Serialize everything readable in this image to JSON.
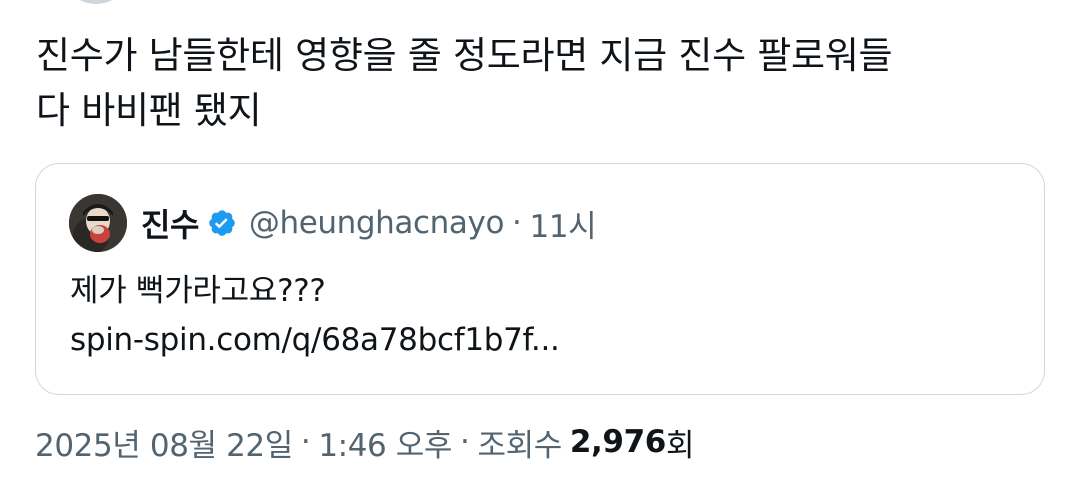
{
  "tweet": {
    "text": "진수가 남들한테 영향을 줄 정도라면 지금 진수 팔로워들\n다 바비팬 됐지"
  },
  "quote": {
    "name": "진수",
    "handle": "@heunghacnayo",
    "dot": "·",
    "time": "11시",
    "text_line1": "제가 뻑가라고요???",
    "link": "spin-spin.com/q/68a78bcf1b7f...",
    "verified_icon": "verified-badge-icon",
    "verified_color": "#1d9bf0"
  },
  "meta": {
    "date": "2025년 08월 22일",
    "sep1": "·",
    "time": "1:46 오후",
    "sep2": "·",
    "views_label": "조회수",
    "views_count": "2,976",
    "views_unit": "회"
  }
}
